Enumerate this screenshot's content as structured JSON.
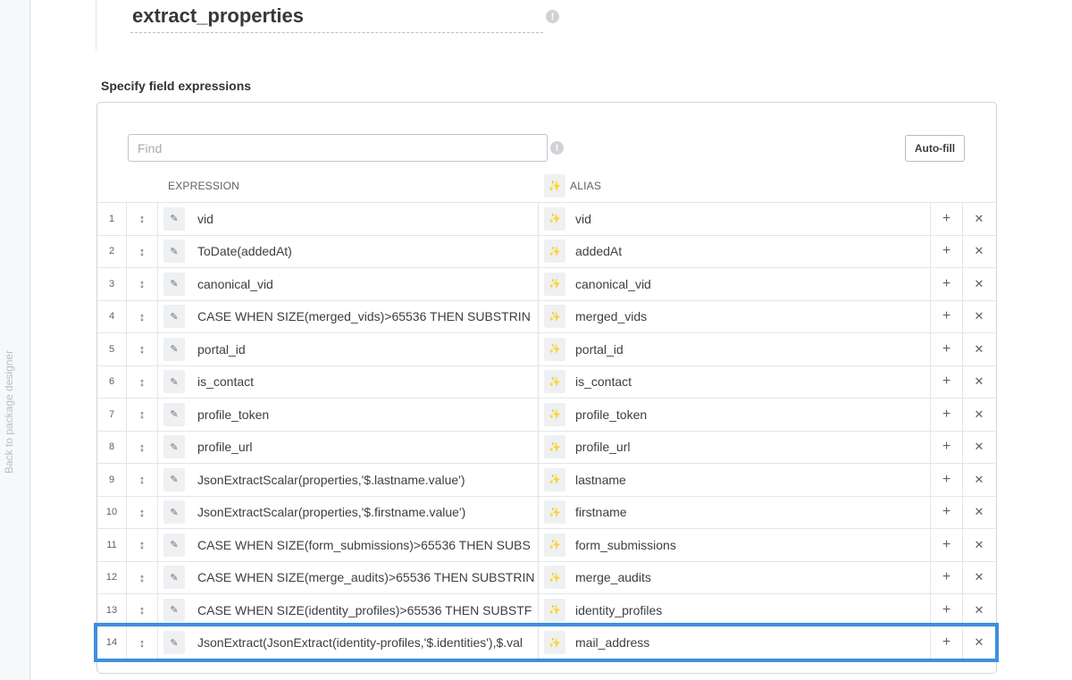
{
  "sidebar": {
    "back_label": "Back to package designer"
  },
  "component": {
    "name": "extract_properties",
    "info_icon": "!"
  },
  "fields": {
    "heading": "Specify field expressions",
    "find_placeholder": "Find",
    "autofill_label": "Auto-fill",
    "columns": {
      "expression": "EXPRESSION",
      "alias": "ALIAS"
    },
    "rows": [
      {
        "num": "1",
        "expression": "vid",
        "alias": "vid"
      },
      {
        "num": "2",
        "expression": "ToDate(addedAt)",
        "alias": "addedAt"
      },
      {
        "num": "3",
        "expression": "canonical_vid",
        "alias": "canonical_vid"
      },
      {
        "num": "4",
        "expression": "CASE WHEN SIZE(merged_vids)>65536 THEN SUBSTRIN",
        "alias": "merged_vids"
      },
      {
        "num": "5",
        "expression": "portal_id",
        "alias": "portal_id"
      },
      {
        "num": "6",
        "expression": "is_contact",
        "alias": "is_contact"
      },
      {
        "num": "7",
        "expression": "profile_token",
        "alias": "profile_token"
      },
      {
        "num": "8",
        "expression": "profile_url",
        "alias": "profile_url"
      },
      {
        "num": "9",
        "expression": "JsonExtractScalar(properties,'$.lastname.value')",
        "alias": "lastname"
      },
      {
        "num": "10",
        "expression": "JsonExtractScalar(properties,'$.firstname.value')",
        "alias": "firstname"
      },
      {
        "num": "11",
        "expression": "CASE WHEN SIZE(form_submissions)>65536 THEN SUBS",
        "alias": "form_submissions"
      },
      {
        "num": "12",
        "expression": "CASE WHEN SIZE(merge_audits)>65536 THEN SUBSTRIN",
        "alias": "merge_audits"
      },
      {
        "num": "13",
        "expression": "CASE WHEN SIZE(identity_profiles)>65536 THEN SUBSTF",
        "alias": "identity_profiles"
      },
      {
        "num": "14",
        "expression": "JsonExtract(JsonExtract(identity-profiles,'$.identities'),$.val",
        "alias": "mail_address",
        "selected": true
      }
    ]
  },
  "icons": {
    "drag": "drag-handle-icon",
    "edit": "edit-icon",
    "wand": "magic-wand-icon",
    "add": "plus-icon",
    "remove": "close-icon"
  },
  "colors": {
    "selection": "#3d8fe0"
  }
}
